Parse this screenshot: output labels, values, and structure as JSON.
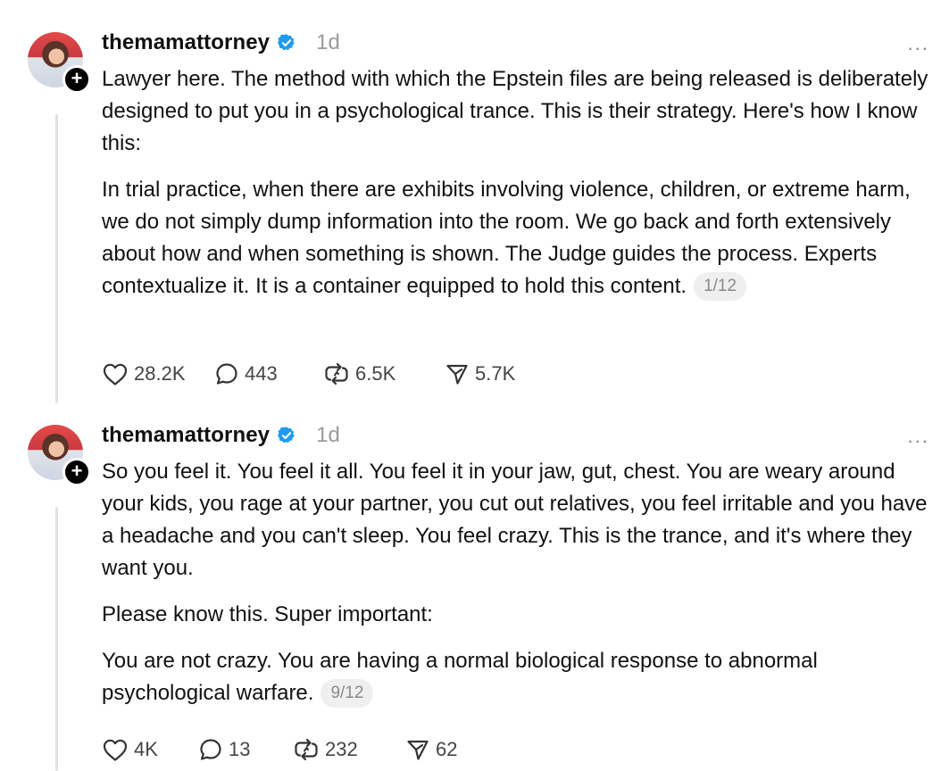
{
  "posts": [
    {
      "username": "themamattorney",
      "time": "1d",
      "more": "...",
      "paragraphs": [
        "Lawyer here. The method with which the Epstein files are being released is deliberately designed to put you in a psychological trance. This is their strategy. Here's how I know this:",
        "In trial practice, when there are exhibits involving violence, children, or extreme harm, we do not simply dump information into the room. We go back and forth extensively about how and when something is shown. The Judge guides the process. Experts contextualize it. It is a container equipped to hold this content."
      ],
      "counter": "1/12",
      "likes": "28.2K",
      "replies": "443",
      "reposts": "6.5K",
      "shares": "5.7K"
    },
    {
      "username": "themamattorney",
      "time": "1d",
      "more": "...",
      "paragraphs": [
        "So you feel it. You feel it all. You feel it in your jaw, gut, chest. You are weary around your kids, you rage at your partner, you cut out relatives, you feel irritable and you have a headache and you can't sleep. You feel crazy. This is the trance, and it's where they want you.",
        "Please know this. Super important:",
        "You are not crazy. You are having a normal biological response to abnormal psychological warfare."
      ],
      "counter": "9/12",
      "likes": "4K",
      "replies": "13",
      "reposts": "232",
      "shares": "62"
    }
  ],
  "colors": {
    "verified": "#1d9bf0",
    "muted": "#9a9a9a",
    "text": "#111111"
  },
  "icons": {
    "verified": "verified-badge-icon",
    "like": "heart-icon",
    "reply": "speech-bubble-icon",
    "repost": "repost-icon",
    "share": "paper-plane-icon",
    "more": "ellipsis-icon",
    "follow": "plus-icon"
  }
}
